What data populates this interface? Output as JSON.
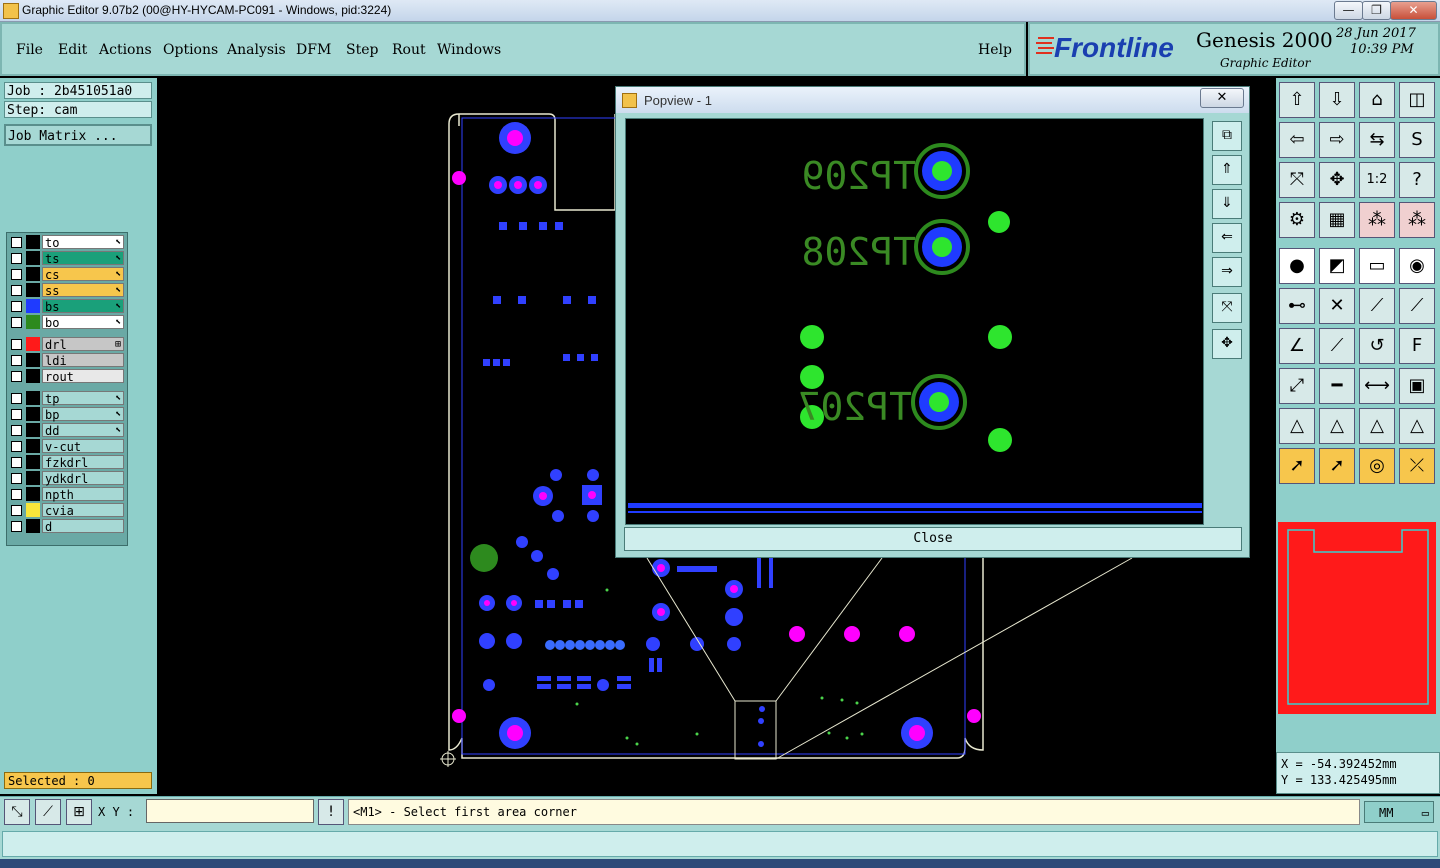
{
  "window": {
    "title": "Graphic Editor 9.07b2 (00@HY-HYCAM-PC091 - Windows, pid:3224)",
    "min": "—",
    "max": "❐",
    "close": "✕"
  },
  "menu": [
    "File",
    "Edit",
    "Actions",
    "Options",
    "Analysis",
    "DFM",
    "Step",
    "Rout",
    "Windows"
  ],
  "help": "Help",
  "brand": {
    "logo": "Frontline",
    "product": "Genesis 2000",
    "subtitle": "Graphic Editor",
    "date": "28 Jun 2017",
    "time": "10:39 PM"
  },
  "job": {
    "label": "Job : 2b451051a0",
    "step": "Step: cam",
    "matrix": "Job Matrix ..."
  },
  "layers": [
    {
      "name": "to",
      "color": "#ffffff",
      "swatch": "#000000",
      "flag": "⬉"
    },
    {
      "name": "ts",
      "color": "#1aa07a",
      "swatch": "#000000",
      "flag": "⬉"
    },
    {
      "name": "cs",
      "color": "#f7c64c",
      "swatch": "#000000",
      "flag": "⬉"
    },
    {
      "name": "ss",
      "color": "#f7c64c",
      "swatch": "#000000",
      "flag": "⬉"
    },
    {
      "name": "bs",
      "color": "#1aa07a",
      "swatch": "#1f3bff",
      "flag": "⬉"
    },
    {
      "name": "bo",
      "color": "#ffffff",
      "swatch": "#2d8a1e",
      "flag": "⬉"
    },
    {
      "name": "drl",
      "color": "#c6c6c6",
      "swatch": "#ff1a1a",
      "flag": "⊞"
    },
    {
      "name": "ldi",
      "color": "#c6c6c6",
      "swatch": "#000000",
      "flag": ""
    },
    {
      "name": "rout",
      "color": "#e8e8e8",
      "swatch": "#000000",
      "flag": ""
    },
    {
      "name": "tp",
      "color": "#a6d8d4",
      "swatch": "#000000",
      "flag": "⬉"
    },
    {
      "name": "bp",
      "color": "#a6d8d4",
      "swatch": "#000000",
      "flag": "⬉"
    },
    {
      "name": "dd",
      "color": "#a6d8d4",
      "swatch": "#000000",
      "flag": "⬉"
    },
    {
      "name": "v-cut",
      "color": "#a6d8d4",
      "swatch": "#000000",
      "flag": ""
    },
    {
      "name": "fzkdrl",
      "color": "#a6d8d4",
      "swatch": "#000000",
      "flag": ""
    },
    {
      "name": "ydkdrl",
      "color": "#a6d8d4",
      "swatch": "#000000",
      "flag": ""
    },
    {
      "name": "npth",
      "color": "#a6d8d4",
      "swatch": "#000000",
      "flag": ""
    },
    {
      "name": "cvia",
      "color": "#a6d8d4",
      "swatch": "#f7e63a",
      "flag": ""
    },
    {
      "name": "d",
      "color": "#a6d8d4",
      "swatch": "#000000",
      "flag": ""
    }
  ],
  "selected": "Selected : 0",
  "popview": {
    "title": "Popview - 1",
    "close": "Close",
    "labels": [
      "TP209",
      "TP208",
      "TP207"
    ]
  },
  "coords": {
    "x": "X = -54.392452mm",
    "y": "Y = 133.425495mm"
  },
  "cmd": {
    "xy_label": "X Y :",
    "xy_value": "",
    "prompt": "<M1> - Select first area corner",
    "units": "MM"
  }
}
